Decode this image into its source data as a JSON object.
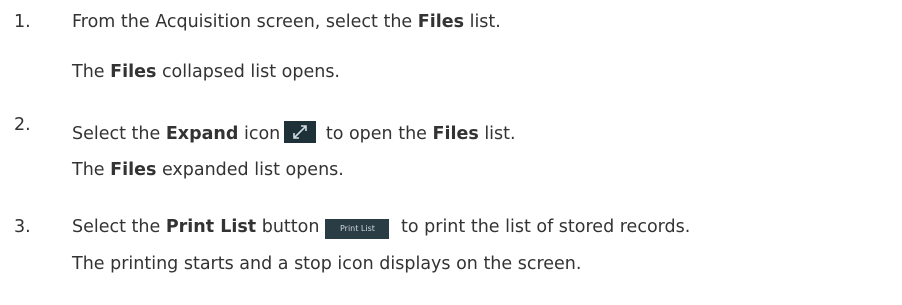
{
  "steps": [
    {
      "number": "1.",
      "line1": {
        "pre": "From the Acquisition screen, select the ",
        "bold": "Files",
        "post": " list."
      },
      "line2": {
        "pre": "The ",
        "bold": "Files",
        "post": " collapsed list opens."
      }
    },
    {
      "number": "2.",
      "line1": {
        "pre": "Select the ",
        "bold1": "Expand",
        "mid1": " icon",
        "icon": "expand-icon",
        "mid2": " to open the ",
        "bold2": "Files",
        "post": " list."
      },
      "line2": {
        "pre": "The ",
        "bold": "Files",
        "post": " expanded list opens."
      }
    },
    {
      "number": "3.",
      "line1": {
        "pre": "Select the ",
        "bold": "Print List",
        "mid": " button",
        "button_label": "Print List",
        "post": " to print the list of stored records."
      },
      "line2": {
        "text": "The printing starts and a stop icon displays on the screen."
      }
    }
  ]
}
